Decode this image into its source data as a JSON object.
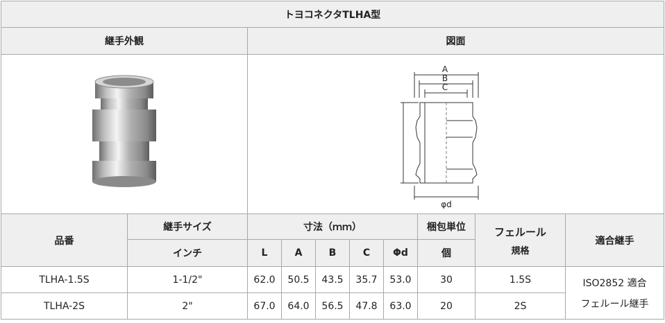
{
  "title": "トヨコネクタTLHA型",
  "headers": {
    "appearance": "継手外観",
    "drawing": "図面",
    "part_number": "品番",
    "fitting_size": "継手サイズ",
    "inch": "インチ",
    "dimensions": "寸法（ｍｍ）",
    "dim_L": "L",
    "dim_A": "A",
    "dim_B": "B",
    "dim_C": "C",
    "dim_d": "Φd",
    "pack_unit": "梱包単位",
    "pack_unit_sub": "個",
    "ferrule": "フェルール",
    "ferrule_sub": "規格",
    "compatible": "適合継手"
  },
  "drawing_labels": {
    "A": "A",
    "B": "B",
    "C": "C",
    "L": "L",
    "d": "φd"
  },
  "rows": [
    {
      "part": "TLHA-1.5S",
      "inch": "1-1/2\"",
      "L": "62.0",
      "A": "50.5",
      "B": "43.5",
      "C": "35.7",
      "d": "53.0",
      "pack": "30",
      "ferrule": "1.5S"
    },
    {
      "part": "TLHA-2S",
      "inch": "2\"",
      "L": "67.0",
      "A": "64.0",
      "B": "56.5",
      "C": "47.8",
      "d": "63.0",
      "pack": "20",
      "ferrule": "2S"
    }
  ],
  "compatible_line1": "ISO2852 適合",
  "compatible_line2": "フェルール継手"
}
